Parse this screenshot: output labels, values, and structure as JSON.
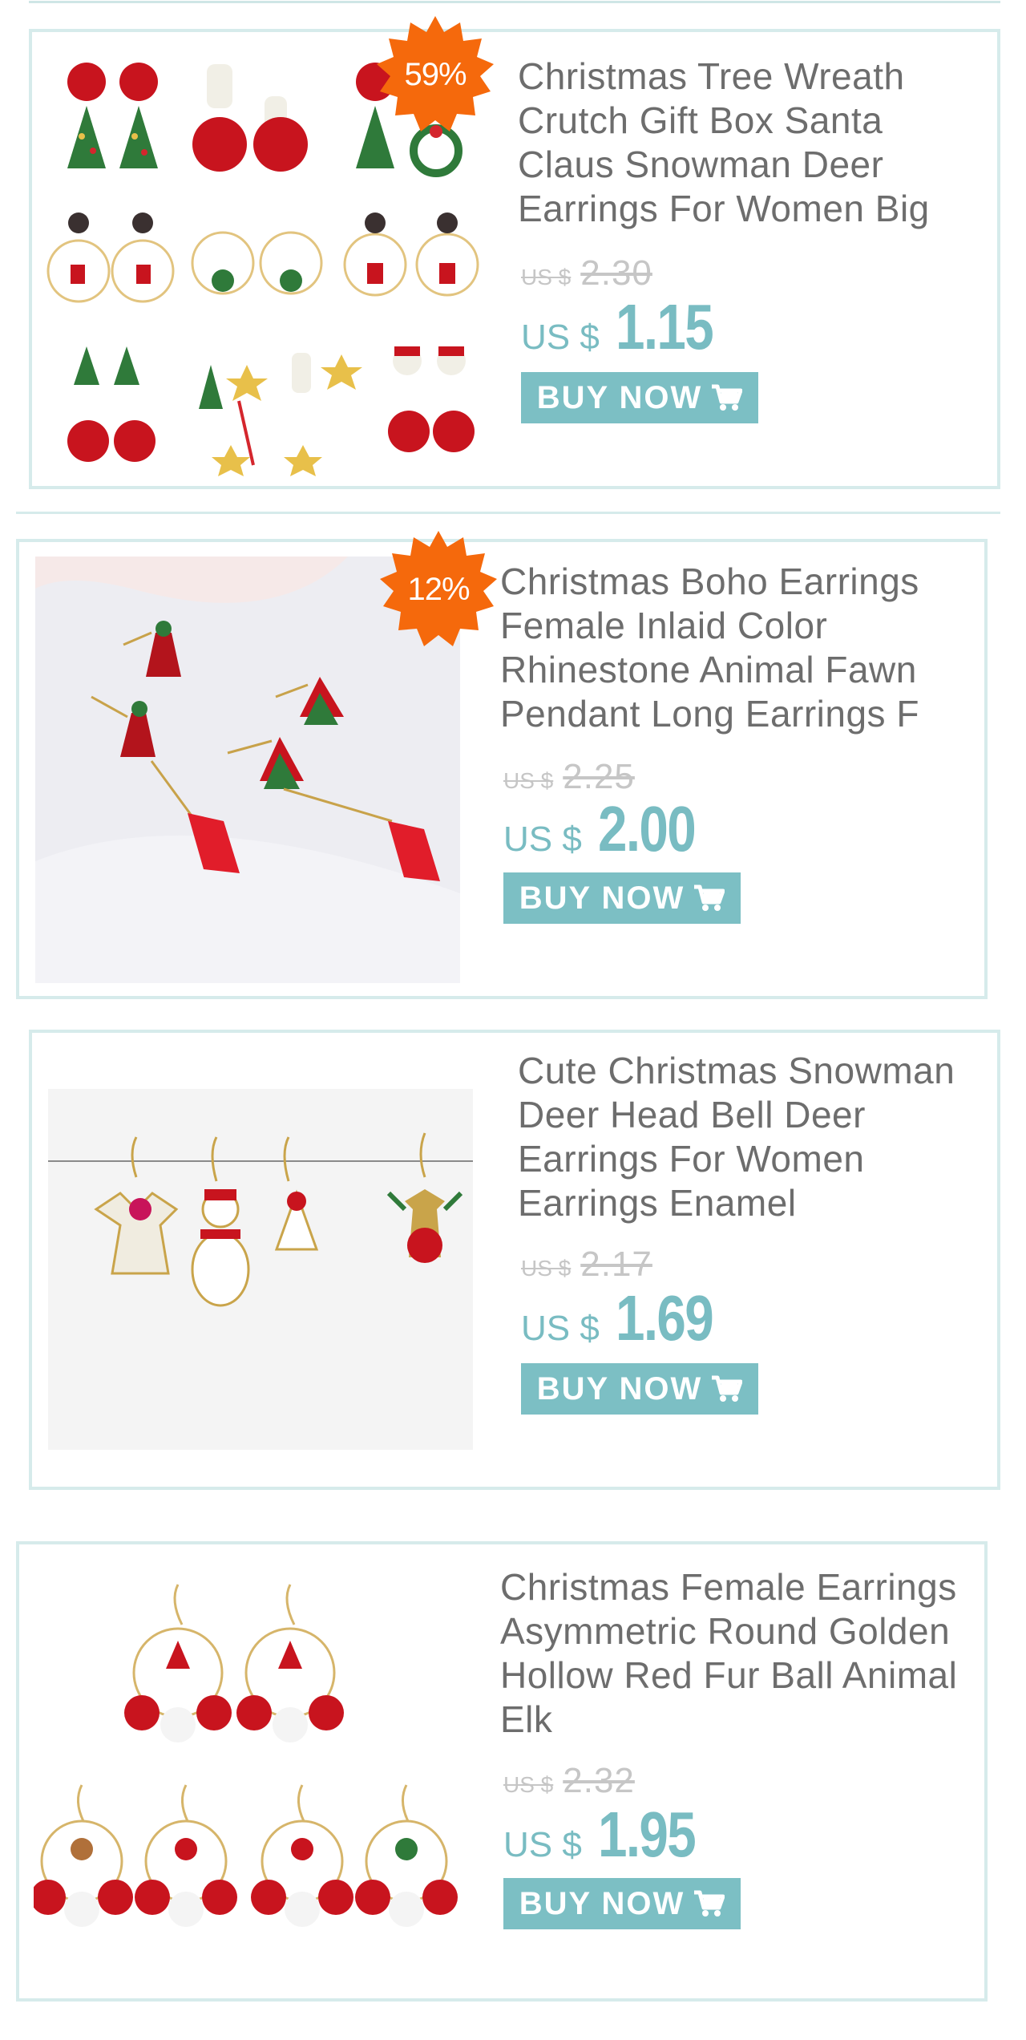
{
  "products": [
    {
      "badge": "59%",
      "title": "Christmas Tree Wreath Crutch Gift Box Santa Claus Snowman Deer Earrings For Women Big",
      "old_currency": "US $",
      "old_price": "2.30",
      "currency": "US $",
      "price": "1.15",
      "button": "BUY NOW"
    },
    {
      "badge": "12%",
      "title": "Christmas Boho Earrings Female Inlaid Color Rhinestone Animal Fawn Pendant Long Earrings F",
      "old_currency": "US $",
      "old_price": "2.25",
      "currency": "US $",
      "price": "2.00",
      "button": "BUY NOW"
    },
    {
      "title": "Cute Christmas Snowman Deer Head Bell Deer Earrings For Women Earrings Enamel",
      "old_currency": "US $",
      "old_price": "2.17",
      "currency": "US $",
      "price": "1.69",
      "button": "BUY NOW"
    },
    {
      "title": "Christmas Female Earrings Asymmetric Round Golden Hollow Red Fur Ball Animal Elk",
      "old_currency": "US $",
      "old_price": "2.32",
      "currency": "US $",
      "price": "1.95",
      "button": "BUY NOW"
    }
  ],
  "colors": {
    "accent": "#7cbfc4",
    "badge": "#f5690c",
    "border": "#d6ebeb",
    "title": "#6d6d6d",
    "old_price": "#c6c6c6"
  }
}
